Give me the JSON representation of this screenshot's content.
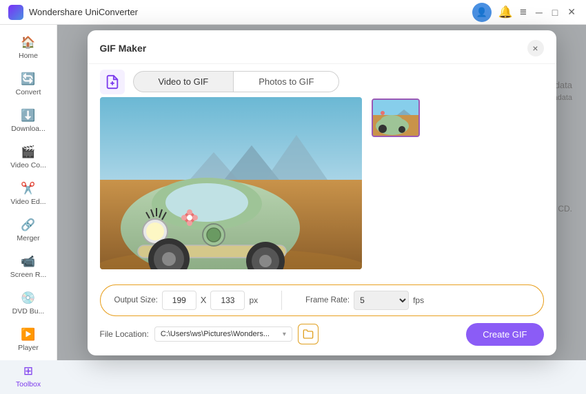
{
  "app": {
    "title": "Wondershare UniConverter"
  },
  "titlebar": {
    "user_icon": "👤",
    "notif_icon": "🔔",
    "menu_icon": "≡"
  },
  "sidebar": {
    "items": [
      {
        "id": "home",
        "label": "Home",
        "icon": "🏠"
      },
      {
        "id": "convert",
        "label": "Convert",
        "icon": "🔄"
      },
      {
        "id": "download",
        "label": "Downloa...",
        "icon": "⬇️"
      },
      {
        "id": "video-compress",
        "label": "Video Co...",
        "icon": "🎬"
      },
      {
        "id": "video-edit",
        "label": "Video Ed...",
        "icon": "✂️"
      },
      {
        "id": "merger",
        "label": "Merger",
        "icon": "🔗"
      },
      {
        "id": "screen-record",
        "label": "Screen R...",
        "icon": "📹"
      },
      {
        "id": "dvd-burn",
        "label": "DVD Bu...",
        "icon": "💿"
      },
      {
        "id": "player",
        "label": "Player",
        "icon": "▶️"
      },
      {
        "id": "toolbox",
        "label": "Toolbox",
        "icon": "⊞"
      }
    ]
  },
  "dialog": {
    "title": "GIF Maker",
    "close_label": "×",
    "tabs": [
      {
        "id": "video-to-gif",
        "label": "Video to GIF",
        "active": true
      },
      {
        "id": "photos-to-gif",
        "label": "Photos to GIF",
        "active": false
      }
    ],
    "settings": {
      "output_size_label": "Output Size:",
      "width_value": "199",
      "x_sep": "X",
      "height_value": "133",
      "px_unit": "px",
      "frame_rate_label": "Frame Rate:",
      "frame_rate_value": "5",
      "fps_unit": "fps"
    },
    "file_location": {
      "label": "File Location:",
      "path": "C:\\Users\\ws\\Pictures\\Wonders...",
      "browse_icon": "📁"
    },
    "create_gif_label": "Create GIF"
  },
  "background": {
    "meta_label": "data",
    "meta_sub": "nstadata",
    "cd_label": "CD."
  }
}
